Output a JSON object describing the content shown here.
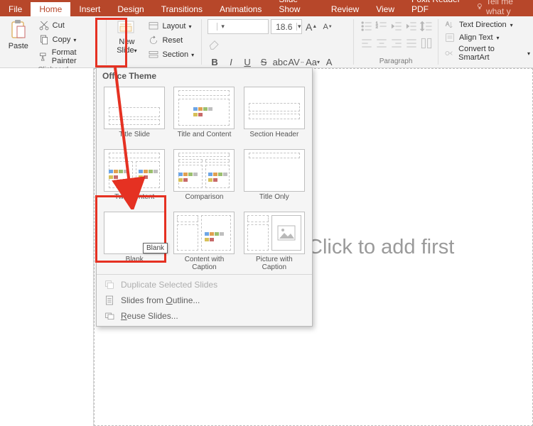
{
  "tabs": {
    "file": "File",
    "home": "Home",
    "insert": "Insert",
    "design": "Design",
    "transitions": "Transitions",
    "animations": "Animations",
    "slideshow": "Slide Show",
    "review": "Review",
    "view": "View",
    "foxit": "Foxit Reader PDF",
    "tell": "Tell me what y"
  },
  "ribbon": {
    "clipboard": {
      "label": "Clipboard",
      "paste": "Paste",
      "cut": "Cut",
      "copy": "Copy",
      "format_painter": "Format Painter"
    },
    "slides": {
      "new_slide_top": "New",
      "new_slide_bottom": "Slide",
      "layout": "Layout",
      "reset": "Reset",
      "section": "Section"
    },
    "font": {
      "size": "18.6"
    },
    "paragraph": {
      "label": "Paragraph"
    },
    "drawing": {
      "text_direction": "Text Direction",
      "align_text": "Align Text",
      "convert_smartart": "Convert to SmartArt"
    }
  },
  "dropdown": {
    "header": "Office Theme",
    "layouts": {
      "title_slide": "Title Slide",
      "title_content": "Title and Content",
      "section_header": "Section Header",
      "two_content": "Two Content",
      "comparison": "Comparison",
      "title_only": "Title Only",
      "blank": "Blank",
      "content_caption_1": "Content with",
      "content_caption_2": "Caption",
      "picture_caption_1": "Picture with",
      "picture_caption_2": "Caption"
    },
    "tooltip": "Blank",
    "menu": {
      "duplicate": "Duplicate Selected Slides",
      "outline": "Slides from Outline...",
      "reuse": "Reuse Slides...",
      "outline_u": "O",
      "reuse_u": "R"
    }
  },
  "slide_placeholder": "Click to add first"
}
